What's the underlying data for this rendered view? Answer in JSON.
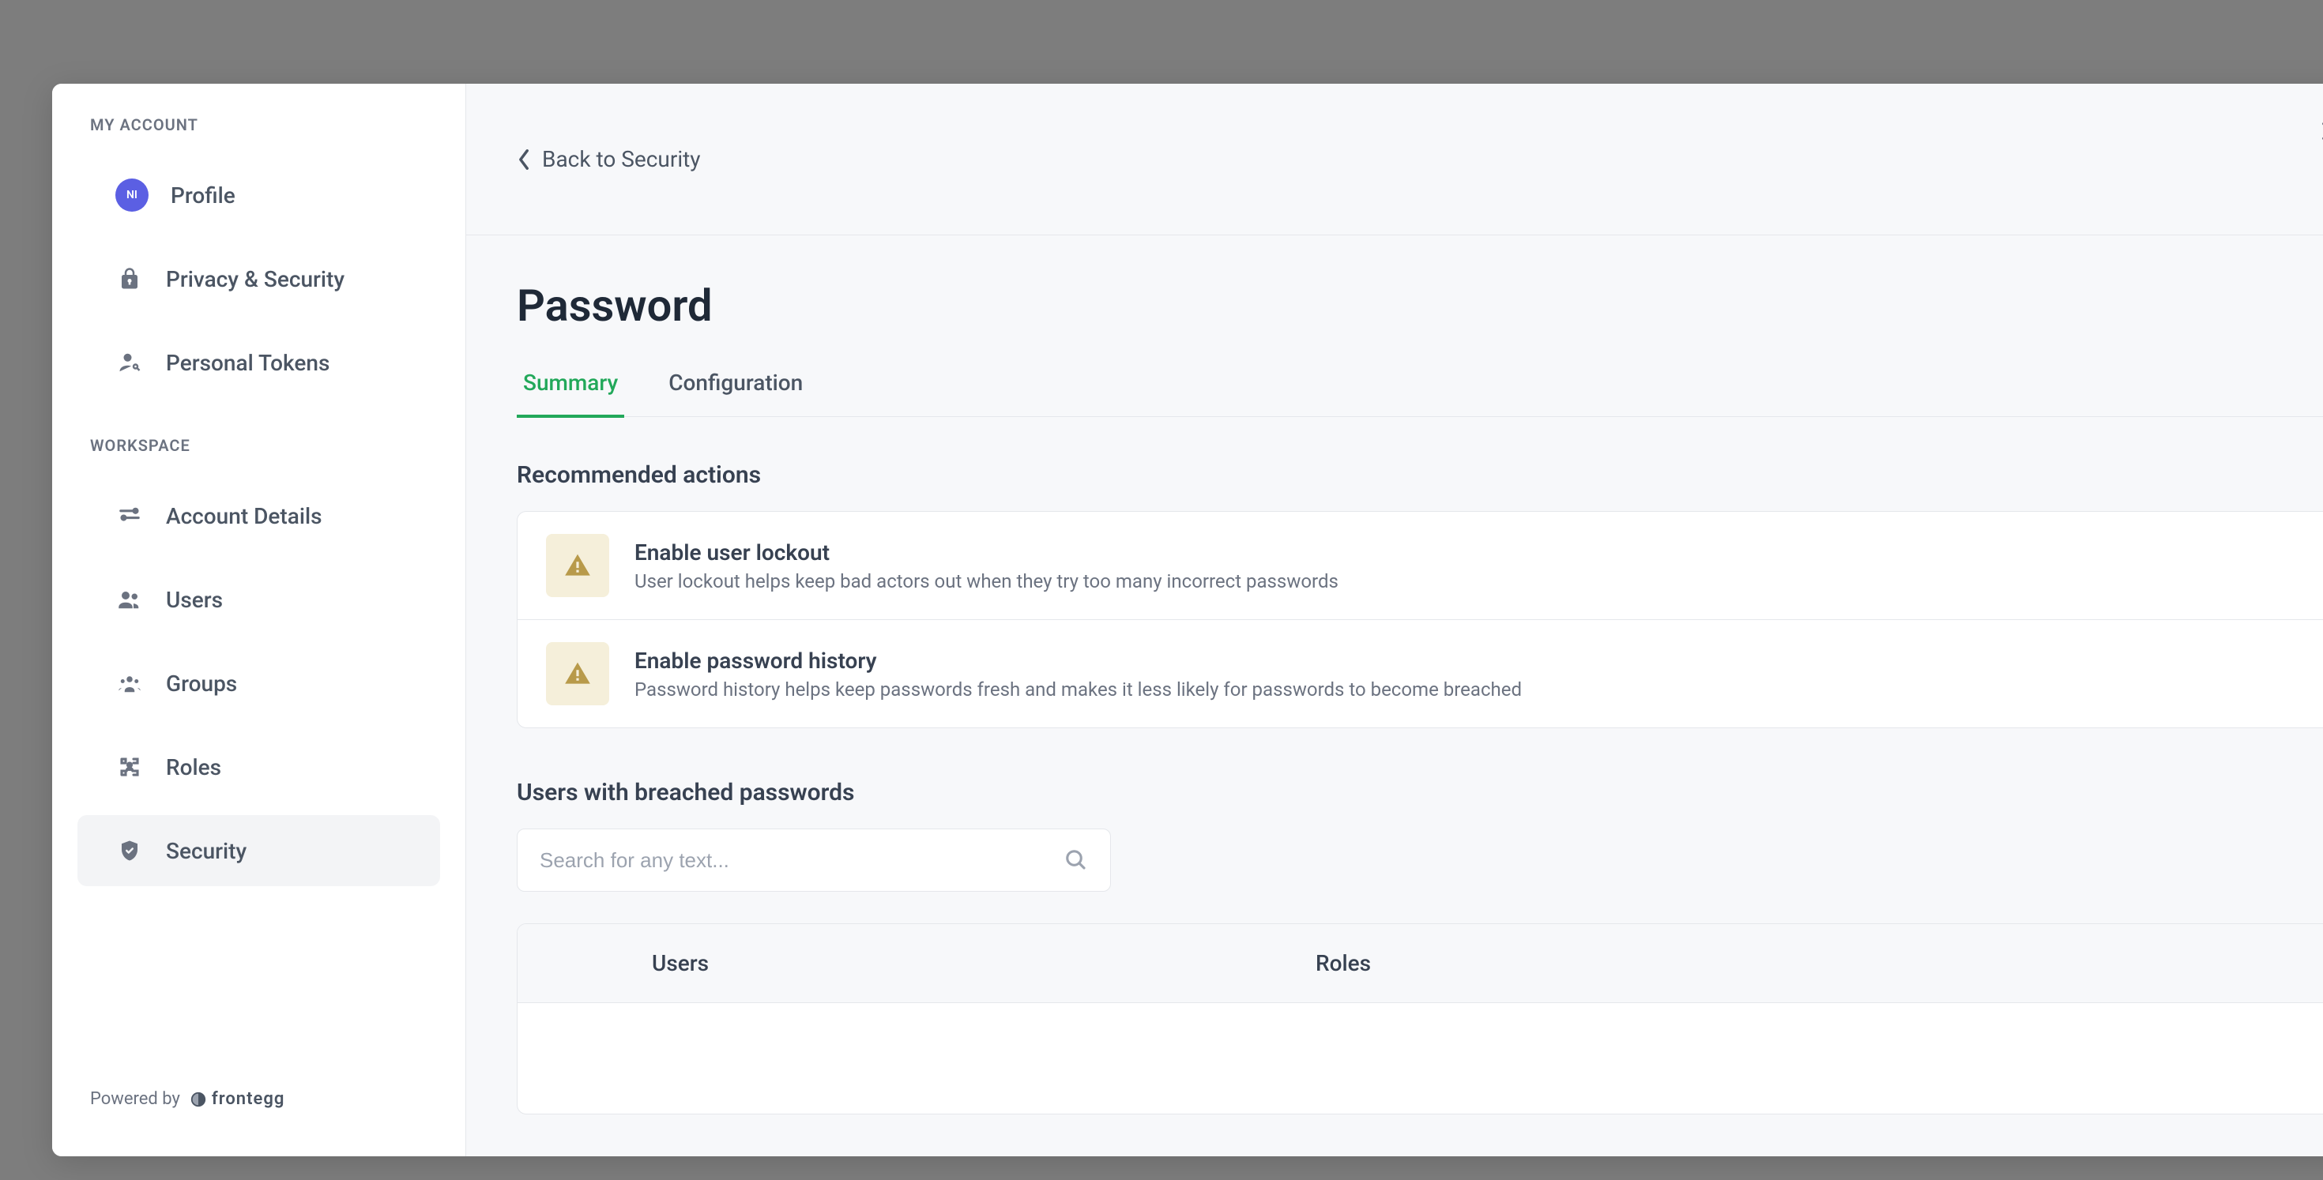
{
  "sidebar": {
    "section_account": "MY ACCOUNT",
    "section_workspace": "WORKSPACE",
    "avatar_initials": "NI",
    "items": {
      "profile": "Profile",
      "privacy": "Privacy & Security",
      "tokens": "Personal Tokens",
      "account_details": "Account Details",
      "users": "Users",
      "groups": "Groups",
      "roles": "Roles",
      "security": "Security"
    },
    "powered_by": "Powered by",
    "brand": "frontegg"
  },
  "header": {
    "back_label": "Back to Security"
  },
  "page": {
    "title": "Password"
  },
  "tabs": {
    "summary": "Summary",
    "configuration": "Configuration"
  },
  "recommended": {
    "heading": "Recommended actions",
    "items": [
      {
        "title": "Enable user lockout",
        "desc": "User lockout helps keep bad actors out when they try too many incorrect passwords"
      },
      {
        "title": "Enable password history",
        "desc": "Password history helps keep passwords fresh and makes it less likely for passwords to become breached"
      }
    ]
  },
  "breached": {
    "heading": "Users with breached passwords",
    "search_placeholder": "Search for any text..."
  },
  "table": {
    "col_users": "Users",
    "col_roles": "Roles"
  }
}
